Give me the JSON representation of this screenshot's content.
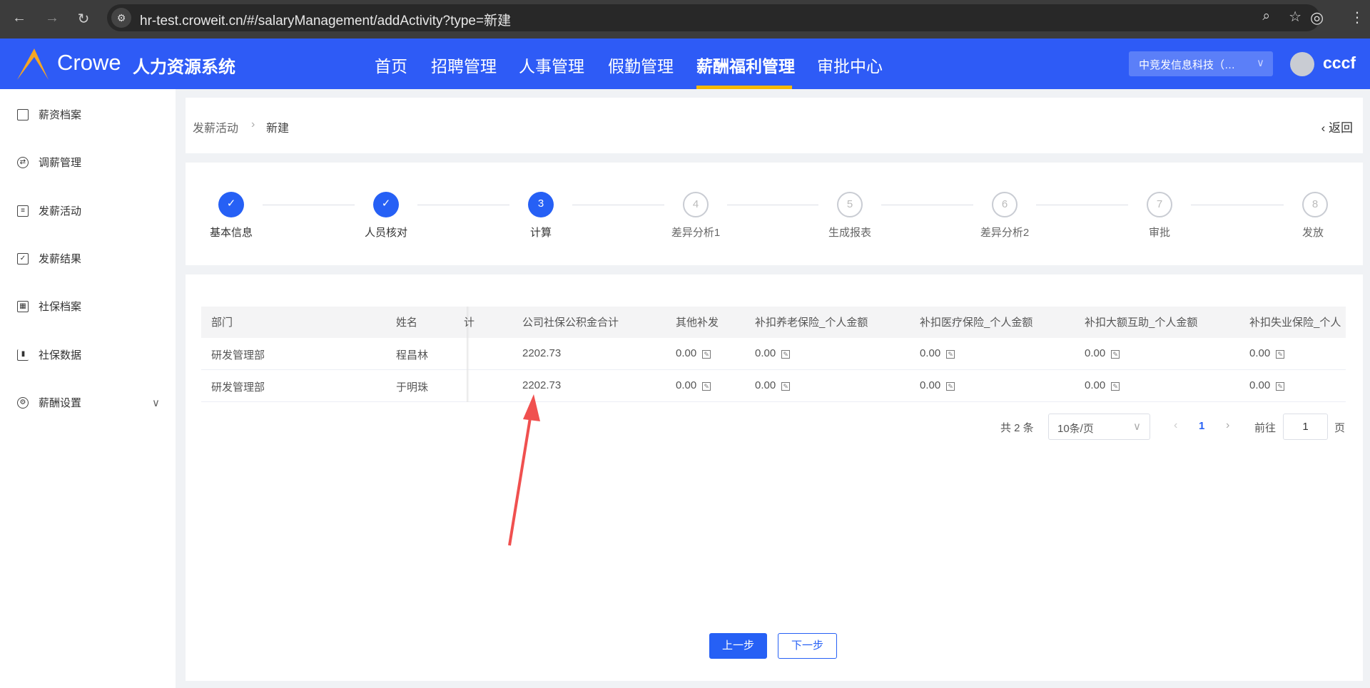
{
  "browser": {
    "url": "hr-test.croweit.cn/#/salaryManagement/addActivity?type=新建"
  },
  "header": {
    "brand": "Crowe",
    "system": "人力资源系统",
    "nav": [
      "首页",
      "招聘管理",
      "人事管理",
      "假勤管理",
      "薪酬福利管理",
      "审批中心"
    ],
    "active_nav": "薪酬福利管理",
    "company": "中竞发信息科技（…",
    "user": "cccf"
  },
  "sidebar": {
    "items": [
      "薪资档案",
      "调薪管理",
      "发薪活动",
      "发薪结果",
      "社保档案",
      "社保数据",
      "薪酬设置"
    ]
  },
  "breadcrumb": {
    "parent": "发薪活动",
    "current": "新建",
    "back": "返回"
  },
  "steps": [
    {
      "n": "1",
      "label": "基本信息",
      "state": "done"
    },
    {
      "n": "2",
      "label": "人员核对",
      "state": "done"
    },
    {
      "n": "3",
      "label": "计算",
      "state": "current"
    },
    {
      "n": "4",
      "label": "差异分析1",
      "state": "todo"
    },
    {
      "n": "5",
      "label": "生成报表",
      "state": "todo"
    },
    {
      "n": "6",
      "label": "差异分析2",
      "state": "todo"
    },
    {
      "n": "7",
      "label": "审批",
      "state": "todo"
    },
    {
      "n": "8",
      "label": "发放",
      "state": "todo"
    }
  ],
  "table": {
    "columns": [
      "部门",
      "姓名",
      "计",
      "公司社保公积金合计",
      "其他补发",
      "补扣养老保险_个人金额",
      "补扣医疗保险_个人金额",
      "补扣大额互助_个人金额",
      "补扣失业保险_个人"
    ],
    "rows": [
      [
        "研发管理部",
        "程昌林",
        "2202.73",
        "0.00",
        "0.00",
        "0.00",
        "0.00",
        "0.00"
      ],
      [
        "研发管理部",
        "于明珠",
        "2202.73",
        "0.00",
        "0.00",
        "0.00",
        "0.00",
        "0.00"
      ]
    ]
  },
  "pagination": {
    "total": "共 2 条",
    "page_size": "10条/页",
    "current": "1",
    "goto": "前往",
    "goto_value": "1",
    "page_suffix": "页"
  },
  "buttons": {
    "prev": "上一步",
    "next": "下一步"
  }
}
